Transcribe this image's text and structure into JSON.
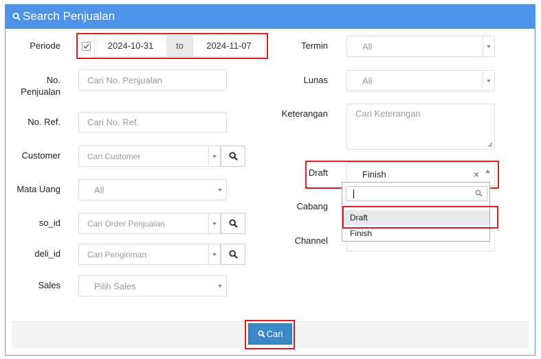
{
  "header": {
    "title": "Search Penjualan"
  },
  "left": {
    "periode": {
      "label": "Periode",
      "checked": true,
      "date_from": "2024-10-31",
      "to_label": "to",
      "date_to": "2024-11-07"
    },
    "no_penjualan": {
      "label_line1": "No.",
      "label_line2": "Penjualan",
      "placeholder": "Cari No. Penjualan"
    },
    "no_ref": {
      "label": "No. Ref.",
      "placeholder": "Cari No. Ref."
    },
    "customer": {
      "label": "Customer",
      "placeholder": "Cari Customer"
    },
    "mata_uang": {
      "label": "Mata Uang",
      "value": "All"
    },
    "so_id": {
      "label": "so_id",
      "placeholder": "Cari Order Penjualan"
    },
    "deli_id": {
      "label": "deli_id",
      "placeholder": "Cari Pengiriman"
    },
    "sales": {
      "label": "Sales",
      "value": "Pilih Sales"
    }
  },
  "right": {
    "termin": {
      "label": "Termin",
      "value": "All"
    },
    "lunas": {
      "label": "Lunas",
      "value": "All"
    },
    "keterangan": {
      "label": "Keterangan",
      "placeholder": "Cari Keterangan"
    },
    "draft": {
      "label": "Draft",
      "value": "Finish",
      "clear": "×"
    },
    "cabang": {
      "label": "Cabang"
    },
    "channel": {
      "label": "Channel"
    },
    "dropdown": {
      "options": [
        "Draft",
        "Finish"
      ]
    }
  },
  "footer": {
    "cari_label": "Cari"
  },
  "icons": [
    "search-icon",
    "check-icon",
    "chevron-down-icon",
    "chevron-up-icon",
    "close-icon"
  ],
  "colors": {
    "header_bg": "#4e93ea",
    "button_bg": "#3a87c9",
    "highlight": "#d62020"
  }
}
